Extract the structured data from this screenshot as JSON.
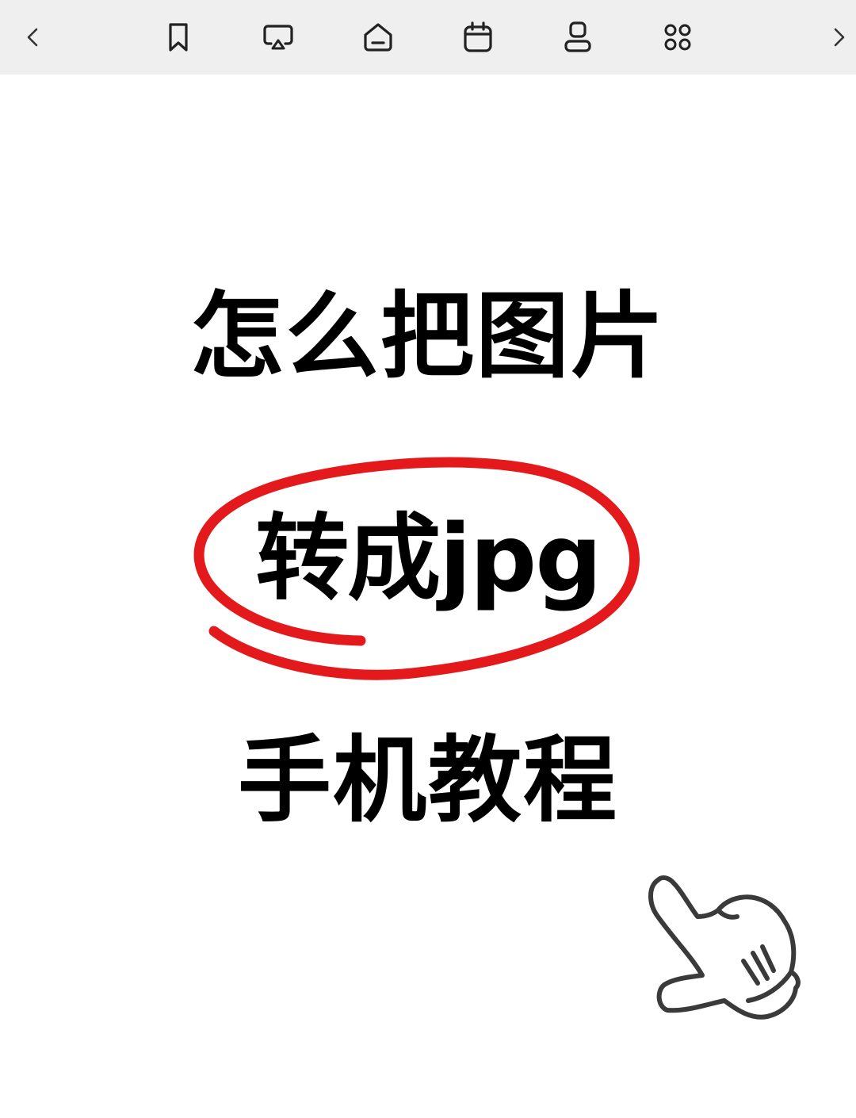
{
  "toolbar": {
    "items": [
      {
        "name": "back",
        "icon": "chevron-left-icon"
      },
      {
        "name": "bookmarks",
        "icon": "bookmark-icon"
      },
      {
        "name": "cast",
        "icon": "screen-cast-icon"
      },
      {
        "name": "home",
        "icon": "home-icon"
      },
      {
        "name": "calendar",
        "icon": "calendar-icon"
      },
      {
        "name": "account",
        "icon": "person-icon"
      },
      {
        "name": "apps",
        "icon": "apps-grid-icon"
      },
      {
        "name": "forward",
        "icon": "chevron-right-icon"
      }
    ]
  },
  "content": {
    "line1": "怎么把图片",
    "line2": "转成jpg",
    "line3": "手机教程",
    "accent_color": "#e3191c",
    "hand_icon": "pointing-hand-icon"
  }
}
